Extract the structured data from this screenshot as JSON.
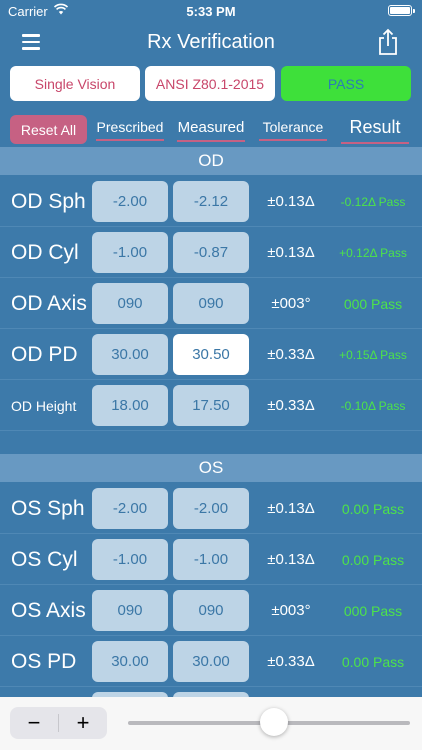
{
  "status_bar": {
    "carrier": "Carrier",
    "time": "5:33 PM"
  },
  "nav": {
    "title": "Rx Verification",
    "menu_icon": "hamburger-icon",
    "share_icon": "share-icon"
  },
  "selectors": {
    "lens_type": "Single Vision",
    "standard": "ANSI Z80.1-2015",
    "overall_result": "PASS"
  },
  "toolbar": {
    "reset_label": "Reset All"
  },
  "columns": {
    "prescribed": "Prescribed",
    "measured": "Measured",
    "tolerance": "Tolerance",
    "result": "Result"
  },
  "sections": [
    {
      "title": "OD",
      "rows": [
        {
          "label": "OD Sph",
          "prescribed": "-2.00",
          "measured": "-2.12",
          "tolerance": "±0.13Δ",
          "result": "-0.12Δ Pass"
        },
        {
          "label": "OD Cyl",
          "prescribed": "-1.00",
          "measured": "-0.87",
          "tolerance": "±0.13Δ",
          "result": "+0.12Δ Pass"
        },
        {
          "label": "OD Axis",
          "prescribed": "090",
          "measured": "090",
          "tolerance": "±003°",
          "result": "000 Pass"
        },
        {
          "label": "OD PD",
          "prescribed": "30.00",
          "measured": "30.50",
          "tolerance": "±0.33Δ",
          "result": "+0.15Δ Pass"
        },
        {
          "label": "OD Height",
          "prescribed": "18.00",
          "measured": "17.50",
          "tolerance": "±0.33Δ",
          "result": "-0.10Δ Pass"
        }
      ]
    },
    {
      "title": "OS",
      "rows": [
        {
          "label": "OS Sph",
          "prescribed": "-2.00",
          "measured": "-2.00",
          "tolerance": "±0.13Δ",
          "result": "0.00 Pass"
        },
        {
          "label": "OS Cyl",
          "prescribed": "-1.00",
          "measured": "-1.00",
          "tolerance": "±0.13Δ",
          "result": "0.00 Pass"
        },
        {
          "label": "OS Axis",
          "prescribed": "090",
          "measured": "090",
          "tolerance": "±003°",
          "result": "000 Pass"
        },
        {
          "label": "OS PD",
          "prescribed": "30.00",
          "measured": "30.00",
          "tolerance": "±0.33Δ",
          "result": "0.00 Pass"
        }
      ]
    }
  ],
  "bottom_bar": {
    "minus": "−",
    "plus": "+",
    "slider_value_fraction": 0.52
  },
  "colors": {
    "background": "#3d7aaa",
    "section_header": "#6899c2",
    "accent_pink": "#c66183",
    "pass_green": "#3ee03a",
    "result_green": "#4de34a",
    "cell_fill": "#bdd4e6"
  }
}
